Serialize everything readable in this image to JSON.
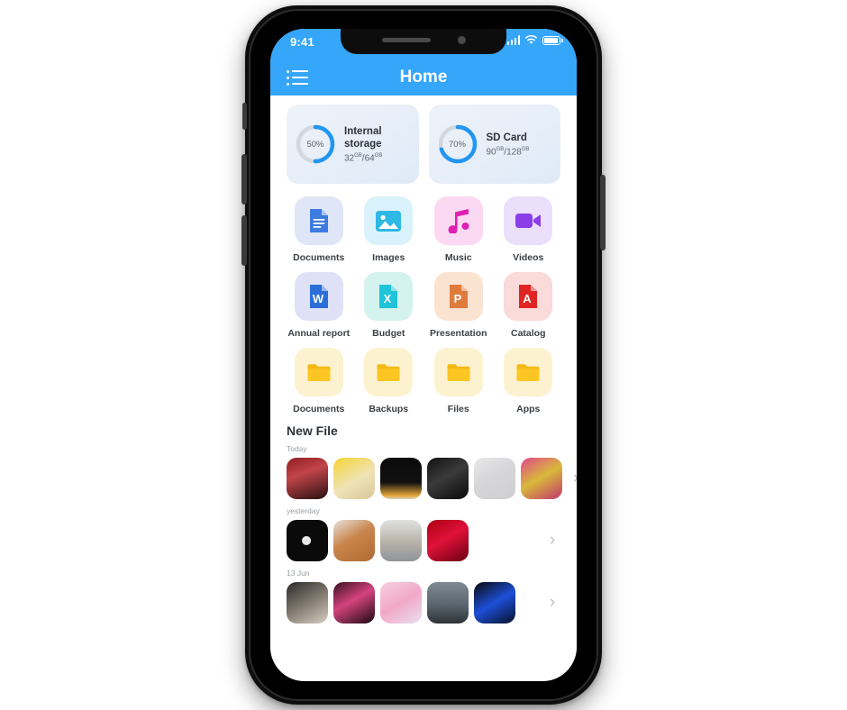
{
  "status_bar": {
    "time": "9:41",
    "signal_icon": "signal-bars-icon",
    "wifi_icon": "wifi-icon",
    "battery_icon": "battery-icon"
  },
  "app_bar": {
    "title": "Home",
    "menu_icon": "list-menu-icon"
  },
  "storage": [
    {
      "name": "Internal storage",
      "percent": 50,
      "percent_label": "50%",
      "used": "32",
      "used_unit": "GB",
      "total": "64",
      "total_unit": "GB",
      "ring_color": "#2196f3",
      "track_color": "#d3d8de"
    },
    {
      "name": "SD Card",
      "percent": 70,
      "percent_label": "70%",
      "used": "90",
      "used_unit": "GB",
      "total": "128",
      "total_unit": "GB",
      "ring_color": "#2196f3",
      "track_color": "#d3d8de"
    }
  ],
  "categories": [
    {
      "label": "Documents",
      "icon": "document-icon",
      "tile_bg": "#dfe6f7",
      "icon_color": "#3d7ce0"
    },
    {
      "label": "Images",
      "icon": "image-icon",
      "tile_bg": "#d9f2fb",
      "icon_color": "#2eb8e6"
    },
    {
      "label": "Music",
      "icon": "music-note-icon",
      "tile_bg": "#fbd9f2",
      "icon_color": "#e01fb4"
    },
    {
      "label": "Videos",
      "icon": "video-camera-icon",
      "tile_bg": "#ebdffb",
      "icon_color": "#8b3ee8"
    }
  ],
  "files": [
    {
      "label": "Annual report",
      "icon": "word-doc-icon",
      "tile_bg": "#dfe2f7",
      "icon_color": "#2b6ed8",
      "badge": "W"
    },
    {
      "label": "Budget",
      "icon": "excel-sheet-icon",
      "tile_bg": "#d4f2ee",
      "icon_color": "#1fc4d8",
      "badge": "X"
    },
    {
      "label": "Presentation",
      "icon": "powerpoint-icon",
      "tile_bg": "#fbe3d2",
      "icon_color": "#e07b3c",
      "badge": "P"
    },
    {
      "label": "Catalog",
      "icon": "pdf-icon",
      "tile_bg": "#fbdada",
      "icon_color": "#e02424",
      "badge": "A"
    }
  ],
  "folders": [
    {
      "label": "Documents",
      "icon": "folder-icon",
      "tile_bg": "#fdf2cf",
      "icon_color": "#f5b916"
    },
    {
      "label": "Backups",
      "icon": "folder-icon",
      "tile_bg": "#fdf2cf",
      "icon_color": "#f5b916"
    },
    {
      "label": "Files",
      "icon": "folder-icon",
      "tile_bg": "#fdf2cf",
      "icon_color": "#f5b916"
    },
    {
      "label": "Apps",
      "icon": "folder-icon",
      "tile_bg": "#fdf2cf",
      "icon_color": "#f5b916"
    }
  ],
  "new_file": {
    "title": "New File",
    "chevron_icon": "chevron-right-icon",
    "groups": [
      {
        "label": "Today",
        "thumbs": [
          {
            "g": "linear-gradient(160deg,#8e1d22 0%,#c2454a 38%,#2a1012 100%)"
          },
          {
            "g": "linear-gradient(150deg,#f5d432 0%,#efe3b6 55%,#d8c79a 100%)"
          },
          {
            "g": "linear-gradient(180deg,#0a0a0a 0%,#111 60%,#e8a93a 92%,#d9d3c8 100%)"
          },
          {
            "g": "linear-gradient(150deg,#111 0%,#3a3a3a 45%,#0a0a0a 100%)"
          },
          {
            "g": "linear-gradient(150deg,#e9e9ea 0%,#d6d6d8 45%,#cfcfd2 100%)"
          },
          {
            "g": "linear-gradient(150deg,#e0478c 0%,#d9b93a 48%,#c2356e 100%)"
          }
        ]
      },
      {
        "label": "yesterday",
        "thumbs": [
          {
            "g": "radial-gradient(circle at 48% 50%, #e8e8e8 0 14%, #0a0a0a 16% 100%)"
          },
          {
            "g": "linear-gradient(150deg,#e8e3dc 0%,#c9854c 45%,#b06a33 100%)"
          },
          {
            "g": "linear-gradient(180deg,#dfe1e2 0%,#b8b2a6 55%,#8e9499 100%)"
          },
          {
            "g": "linear-gradient(150deg,#a8000f 0%,#e0113a 45%,#6a0010 100%)"
          }
        ]
      },
      {
        "label": "13 Jun",
        "thumbs": [
          {
            "g": "linear-gradient(150deg,#2b2b2b 0%,#8a8176 55%,#d8cfc2 100%)"
          },
          {
            "g": "linear-gradient(150deg,#3a1020 0%,#d4437e 45%,#1a0a12 100%)"
          },
          {
            "g": "linear-gradient(150deg,#f6cfe0 0%,#f2a8c8 50%,#e8dff0 100%)"
          },
          {
            "g": "linear-gradient(180deg,#7f8a93 0%,#5b656d 55%,#2e3338 100%)"
          },
          {
            "g": "linear-gradient(150deg,#0a0a0a 0%,#1d4fd8 50%,#081028 100%)"
          }
        ]
      }
    ]
  }
}
